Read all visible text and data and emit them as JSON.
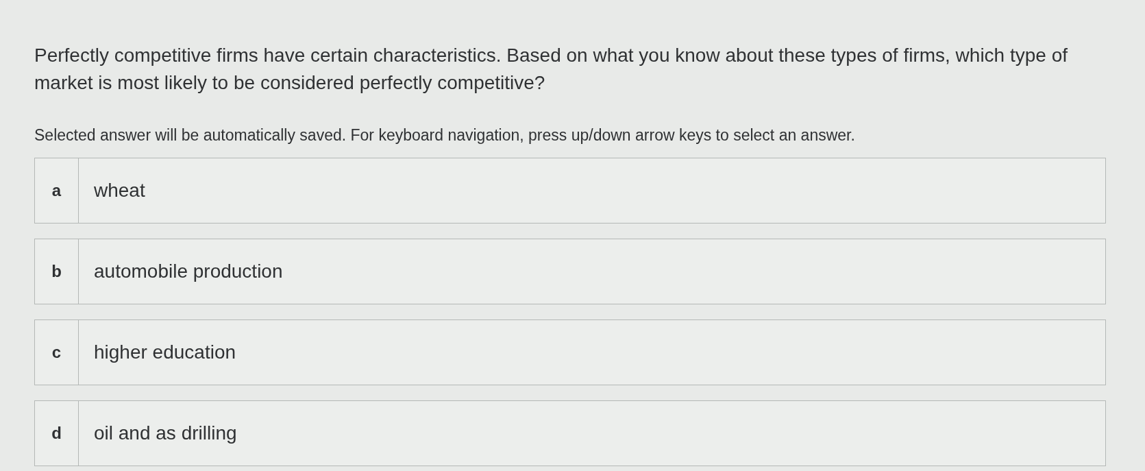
{
  "question": "Perfectly competitive firms have certain characteristics. Based on what you know about these types of firms, which type of market is most likely to be considered perfectly competitive?",
  "instructions": "Selected answer will be automatically saved. For keyboard navigation, press up/down arrow keys to select an answer.",
  "options": [
    {
      "letter": "a",
      "text": "wheat",
      "selected": false
    },
    {
      "letter": "b",
      "text": "automobile production",
      "selected": false
    },
    {
      "letter": "c",
      "text": "higher education",
      "selected": false
    },
    {
      "letter": "d",
      "text": "oil and as drilling",
      "selected": false
    }
  ]
}
